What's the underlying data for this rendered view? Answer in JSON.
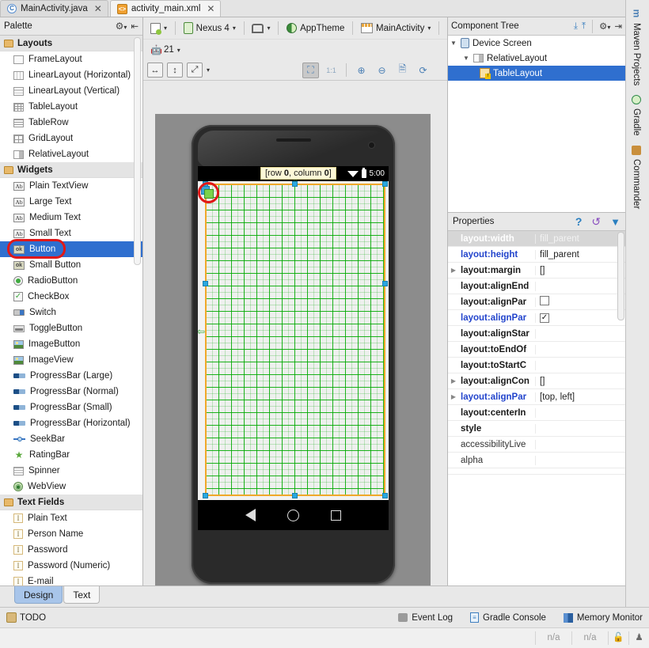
{
  "tabs": [
    {
      "label": "MainActivity.java",
      "icon": "java-class-icon",
      "glyph": "C",
      "active": false
    },
    {
      "label": "activity_main.xml",
      "icon": "xml-layout-icon",
      "glyph": "<>",
      "active": true
    }
  ],
  "palette": {
    "title": "Palette",
    "groups": [
      {
        "name": "Layouts",
        "items": [
          {
            "label": "FrameLayout",
            "icon": "frame-layout-icon"
          },
          {
            "label": "LinearLayout (Horizontal)",
            "icon": "linear-layout-horizontal-icon"
          },
          {
            "label": "LinearLayout (Vertical)",
            "icon": "linear-layout-vertical-icon"
          },
          {
            "label": "TableLayout",
            "icon": "table-layout-icon"
          },
          {
            "label": "TableRow",
            "icon": "table-row-icon"
          },
          {
            "label": "GridLayout",
            "icon": "grid-layout-icon"
          },
          {
            "label": "RelativeLayout",
            "icon": "relative-layout-icon"
          }
        ]
      },
      {
        "name": "Widgets",
        "items": [
          {
            "label": "Plain TextView",
            "icon": "text-ab-icon"
          },
          {
            "label": "Large Text",
            "icon": "text-ab-icon"
          },
          {
            "label": "Medium Text",
            "icon": "text-ab-icon"
          },
          {
            "label": "Small Text",
            "icon": "text-ab-icon"
          },
          {
            "label": "Button",
            "icon": "button-ok-icon",
            "selected": true
          },
          {
            "label": "Small Button",
            "icon": "button-ok-icon"
          },
          {
            "label": "RadioButton",
            "icon": "radio-button-icon"
          },
          {
            "label": "CheckBox",
            "icon": "checkbox-icon"
          },
          {
            "label": "Switch",
            "icon": "switch-icon"
          },
          {
            "label": "ToggleButton",
            "icon": "toggle-button-icon"
          },
          {
            "label": "ImageButton",
            "icon": "image-button-icon"
          },
          {
            "label": "ImageView",
            "icon": "image-view-icon"
          },
          {
            "label": "ProgressBar (Large)",
            "icon": "progress-bar-icon"
          },
          {
            "label": "ProgressBar (Normal)",
            "icon": "progress-bar-icon"
          },
          {
            "label": "ProgressBar (Small)",
            "icon": "progress-bar-icon"
          },
          {
            "label": "ProgressBar (Horizontal)",
            "icon": "progress-bar-icon"
          },
          {
            "label": "SeekBar",
            "icon": "seek-bar-icon"
          },
          {
            "label": "RatingBar",
            "icon": "rating-bar-icon"
          },
          {
            "label": "Spinner",
            "icon": "spinner-icon"
          },
          {
            "label": "WebView",
            "icon": "web-view-icon"
          }
        ]
      },
      {
        "name": "Text Fields",
        "items": [
          {
            "label": "Plain Text",
            "icon": "text-field-icon"
          },
          {
            "label": "Person Name",
            "icon": "text-field-icon"
          },
          {
            "label": "Password",
            "icon": "text-field-icon"
          },
          {
            "label": "Password (Numeric)",
            "icon": "text-field-icon"
          },
          {
            "label": "E-mail",
            "icon": "text-field-icon"
          }
        ]
      }
    ]
  },
  "toolbar": {
    "device_config": "",
    "device": "Nexus 4",
    "orientation": "",
    "theme": "AppTheme",
    "activity": "MainActivity",
    "locale": "",
    "api_level": "21",
    "zoom_fit_width": "fit-width-icon",
    "zoom_fit_height": "fit-height-icon",
    "zoom_fit_screen": "fit-screen-icon",
    "zoom_actual": "1:1",
    "zoom_in": "zoom-in-icon",
    "zoom_out": "zoom-out-icon",
    "render_doc": "document-icon",
    "refresh": "refresh-icon",
    "settings": "gear-icon"
  },
  "preview": {
    "tooltip_prefix": "[row ",
    "tooltip_row": "0",
    "tooltip_mid": ", column ",
    "tooltip_col": "0",
    "tooltip_suffix": "]",
    "status_time": "5:00",
    "nav_back": "back-triangle-icon",
    "nav_home": "home-circle-icon",
    "nav_recents": "recents-square-icon"
  },
  "component_tree": {
    "title": "Component Tree",
    "nodes": [
      {
        "label": "Device Screen",
        "depth": 0,
        "icon": "device-screen-icon",
        "expanded": true,
        "selected": false
      },
      {
        "label": "RelativeLayout",
        "depth": 1,
        "icon": "relative-layout-icon",
        "expanded": true,
        "selected": false
      },
      {
        "label": "TableLayout",
        "depth": 2,
        "icon": "table-layout-warning-icon",
        "expanded": false,
        "selected": true
      }
    ]
  },
  "properties": {
    "title": "Properties",
    "help_icon": "help-icon",
    "restore_icon": "restore-default-icon",
    "filter_icon": "filter-icon",
    "rows": [
      {
        "key": "layout:width",
        "value": "fill_parent",
        "style": "highlight",
        "expand": false
      },
      {
        "key": "layout:height",
        "value": "fill_parent",
        "style": "blue",
        "expand": false
      },
      {
        "key": "layout:margin",
        "value": "[]",
        "style": "bold",
        "expand": true
      },
      {
        "key": "layout:alignEnd",
        "value": "",
        "style": "bold",
        "expand": false
      },
      {
        "key": "layout:alignPar",
        "value": "",
        "style": "bold",
        "expand": false,
        "checkbox": "unchecked"
      },
      {
        "key": "layout:alignPar",
        "value": "",
        "style": "blue",
        "expand": false,
        "checkbox": "checked"
      },
      {
        "key": "layout:alignStar",
        "value": "",
        "style": "bold",
        "expand": false
      },
      {
        "key": "layout:toEndOf",
        "value": "",
        "style": "bold",
        "expand": false
      },
      {
        "key": "layout:toStartC",
        "value": "",
        "style": "bold",
        "expand": false
      },
      {
        "key": "layout:alignCon",
        "value": "[]",
        "style": "bold",
        "expand": true
      },
      {
        "key": "layout:alignPar",
        "value": "[top, left]",
        "style": "blue",
        "expand": true
      },
      {
        "key": "layout:centerIn",
        "value": "",
        "style": "bold",
        "expand": false
      },
      {
        "key": "style",
        "value": "",
        "style": "bold",
        "expand": false
      },
      {
        "key": "accessibilityLive",
        "value": "",
        "style": "plain",
        "expand": false
      },
      {
        "key": "alpha",
        "value": "",
        "style": "plain",
        "expand": false
      }
    ]
  },
  "right_bar": [
    {
      "label": "Maven Projects",
      "icon": "maven-m-icon"
    },
    {
      "label": "Gradle",
      "icon": "gradle-icon"
    },
    {
      "label": "Commander",
      "icon": "commander-icon"
    }
  ],
  "editor_modes": [
    {
      "label": "Design",
      "active": true
    },
    {
      "label": "Text",
      "active": false
    }
  ],
  "status_bar": {
    "todo": "TODO",
    "event_log": "Event Log",
    "gradle_console": "Gradle Console",
    "memory_monitor": "Memory Monitor",
    "cell_1": "n/a",
    "cell_2": "n/a",
    "lock_icon": "unlock-icon",
    "person_icon": "person-icon"
  },
  "colors": {
    "selection_blue": "#2f6fcf",
    "highlight_red": "#e01818",
    "grid_green": "#00aa00",
    "outline_orange": "#f0a82a",
    "handle_blue": "#2aa8e0"
  }
}
